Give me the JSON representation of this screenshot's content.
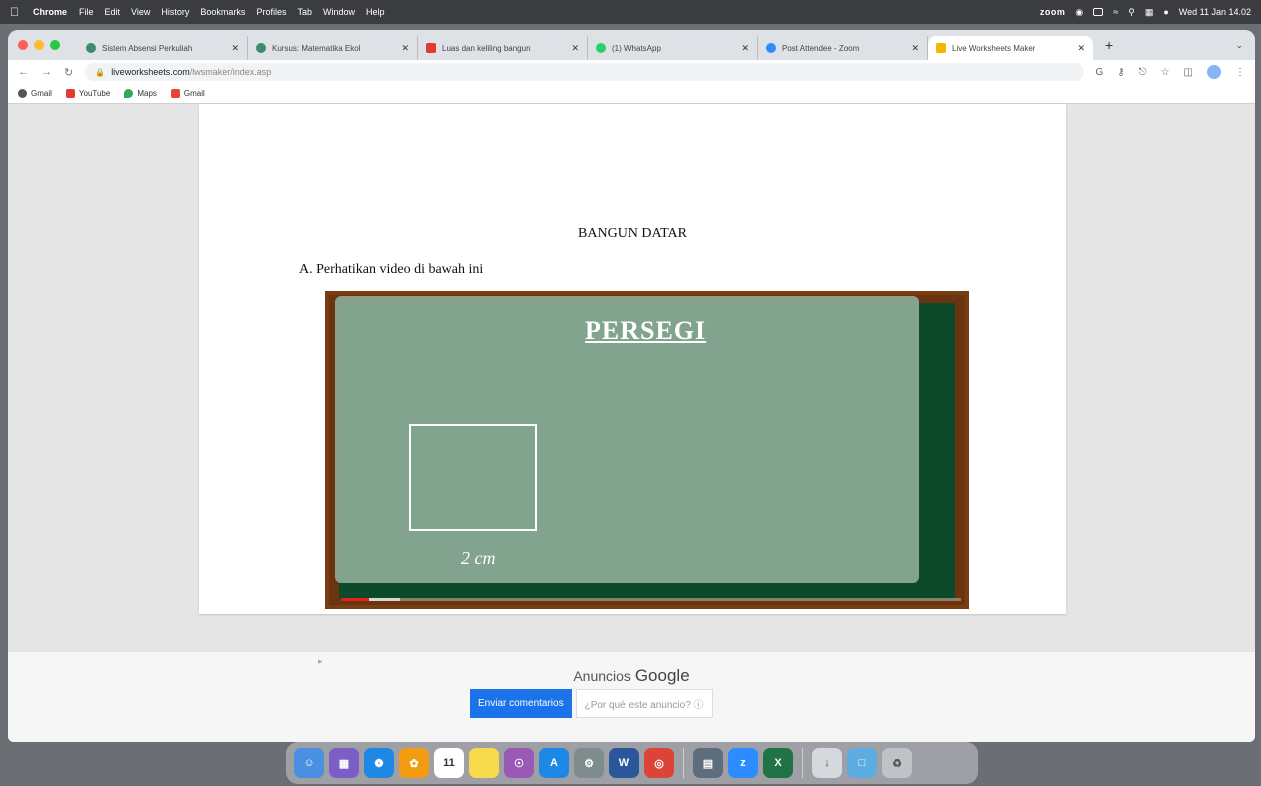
{
  "menubar": {
    "app_name": "Chrome",
    "items": [
      "File",
      "Edit",
      "View",
      "History",
      "Bookmarks",
      "Profiles",
      "Tab",
      "Window",
      "Help"
    ],
    "zoom_label": "zoom",
    "clock": "Wed 11 Jan 14.02"
  },
  "tabs": [
    {
      "title": "Sistem Absensi Perkuliah",
      "color": "#3c8c6c"
    },
    {
      "title": "Kursus: Matematika Ekol",
      "color": "#3c8c6c"
    },
    {
      "title": "Luas dan keliling bangun",
      "color": "#e53935"
    },
    {
      "title": "(1) WhatsApp",
      "color": "#25d366"
    },
    {
      "title": "Post Attendee - Zoom",
      "color": "#2d8cff"
    },
    {
      "title": "Live Worksheets Maker",
      "color": "#f4b400"
    }
  ],
  "address": {
    "host": "liveworksheets.com",
    "path": "/lwsmaker/index.asp"
  },
  "bookmarks": [
    {
      "label": "Gmail",
      "color": "#555555"
    },
    {
      "label": "YouTube",
      "color": "#e53935"
    },
    {
      "label": "Maps",
      "color": "#34a853"
    },
    {
      "label": "Gmail",
      "color": "#ea4335"
    }
  ],
  "worksheet": {
    "title": "BANGUN DATAR",
    "instruction": "A. Perhatikan video di bawah ini"
  },
  "video": {
    "heading": "PERSEGI",
    "dimension": "2 cm",
    "progress_played_percent": 4.5
  },
  "ad": {
    "label_prefix": "Anuncios",
    "label_brand": "Google",
    "feedback_button": "Enviar comentarios",
    "why_button": "¿Por qué este anuncio? ⓘ"
  },
  "dock_apps": [
    {
      "name": "finder-icon",
      "color": "#4a90e2"
    },
    {
      "name": "launchpad-icon",
      "color": "#7b5fc7"
    },
    {
      "name": "safari-icon",
      "color": "#1e88e5"
    },
    {
      "name": "photos-icon",
      "color": "#f39c12"
    },
    {
      "name": "calendar-icon",
      "color": "#ffffff"
    },
    {
      "name": "notes-icon",
      "color": "#f7d94c"
    },
    {
      "name": "podcasts-icon",
      "color": "#9b59b6"
    },
    {
      "name": "appstore-icon",
      "color": "#1e88e5"
    },
    {
      "name": "settings-icon",
      "color": "#7f8c8d"
    },
    {
      "name": "word-icon",
      "color": "#2b579a"
    },
    {
      "name": "chrome-icon",
      "color": "#db4437"
    },
    {
      "name": "preview-icon",
      "color": "#5d6d7e"
    },
    {
      "name": "zoom-icon",
      "color": "#2d8cff"
    },
    {
      "name": "excel-icon",
      "color": "#217346"
    },
    {
      "name": "downloads-icon",
      "color": "#d5d8dc"
    },
    {
      "name": "folder-icon",
      "color": "#5dade2"
    },
    {
      "name": "trash-icon",
      "color": "#bdc3c7"
    }
  ],
  "calendar_day": "11"
}
